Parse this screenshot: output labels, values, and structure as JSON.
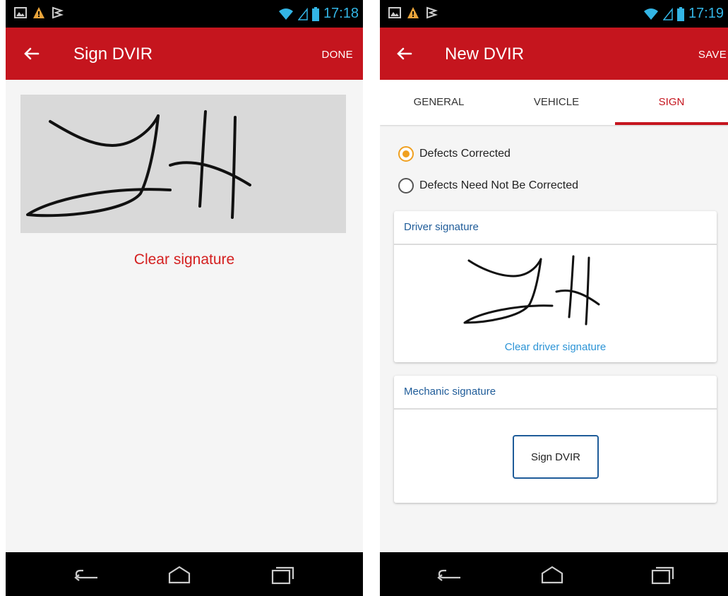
{
  "screen_left": {
    "status": {
      "time": "17:18"
    },
    "appbar": {
      "title": "Sign DVIR",
      "action_label": "DONE"
    },
    "signature": {
      "clear_label": "Clear signature"
    }
  },
  "screen_right": {
    "status": {
      "time": "17:19"
    },
    "appbar": {
      "title": "New DVIR",
      "action_label": "SAVE"
    },
    "tabs": [
      {
        "label": "GENERAL",
        "active": false
      },
      {
        "label": "VEHICLE",
        "active": false
      },
      {
        "label": "SIGN",
        "active": true
      }
    ],
    "radios": [
      {
        "label": "Defects Corrected",
        "checked": true
      },
      {
        "label": "Defects Need Not Be Corrected",
        "checked": false
      }
    ],
    "driver_card": {
      "title": "Driver signature",
      "clear_label": "Clear driver signature"
    },
    "mechanic_card": {
      "title": "Mechanic signature",
      "sign_button_label": "Sign DVIR"
    }
  },
  "colors": {
    "appbar": "#c5151e",
    "accent_red": "#d42020",
    "link_blue": "#2c94d6",
    "header_blue": "#1f5c99",
    "radio_checked": "#f0a020",
    "status_icons": "#33b5e5"
  },
  "icons": [
    "gallery-icon",
    "warning-icon",
    "flag-icon",
    "wifi-icon",
    "signal-icon",
    "battery-icon",
    "back-arrow-icon",
    "nav-back-icon",
    "nav-home-icon",
    "nav-recents-icon"
  ]
}
